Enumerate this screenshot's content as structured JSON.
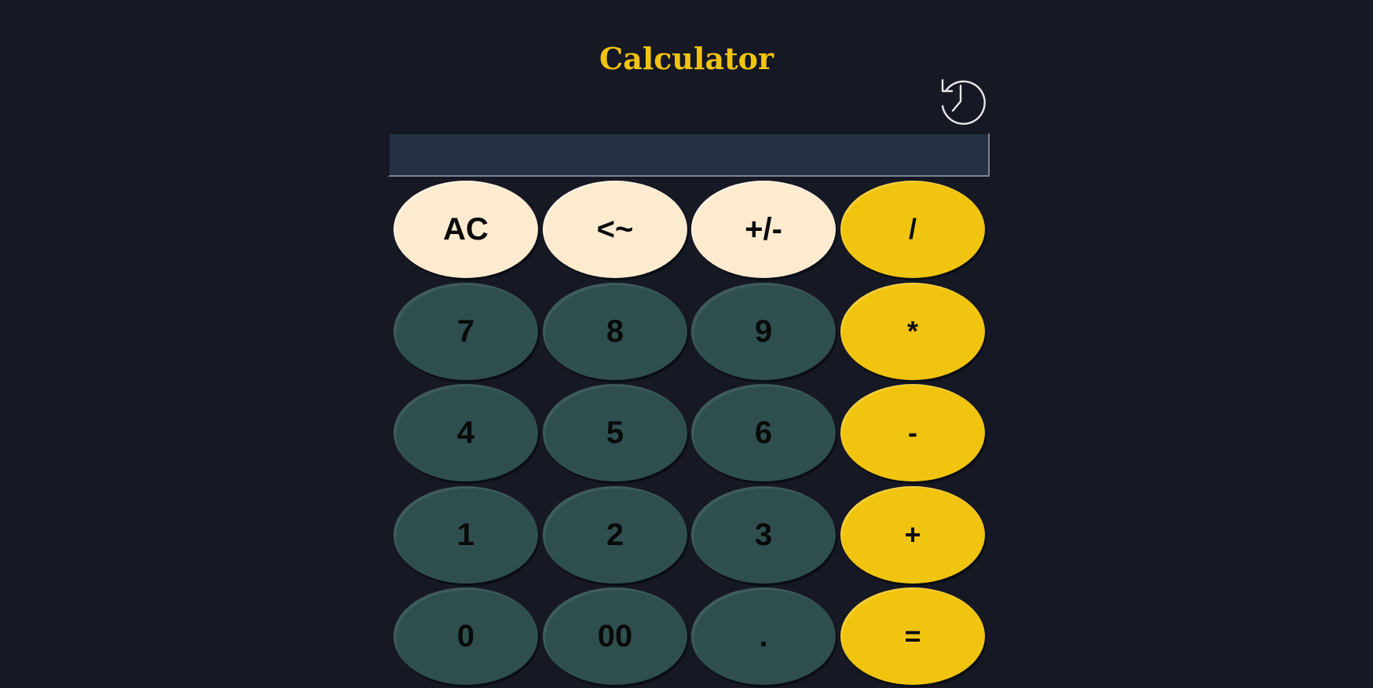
{
  "app": {
    "title": "Calculator"
  },
  "history_button": {
    "icon": "history-icon"
  },
  "display": {
    "value": ""
  },
  "keys": {
    "ac": "AC",
    "backspace": "<~",
    "sign": "+/-",
    "divide": "/",
    "seven": "7",
    "eight": "8",
    "nine": "9",
    "multiply": "*",
    "four": "4",
    "five": "5",
    "six": "6",
    "minus": "-",
    "one": "1",
    "two": "2",
    "three": "3",
    "plus": "+",
    "zero": "0",
    "double_zero": "00",
    "decimal": ".",
    "equals": "="
  },
  "colors": {
    "background": "#161824",
    "accent": "#f1c40f",
    "utility_key": "#fdebd0",
    "number_key": "#2f4f4f",
    "display_bg": "#253042"
  }
}
